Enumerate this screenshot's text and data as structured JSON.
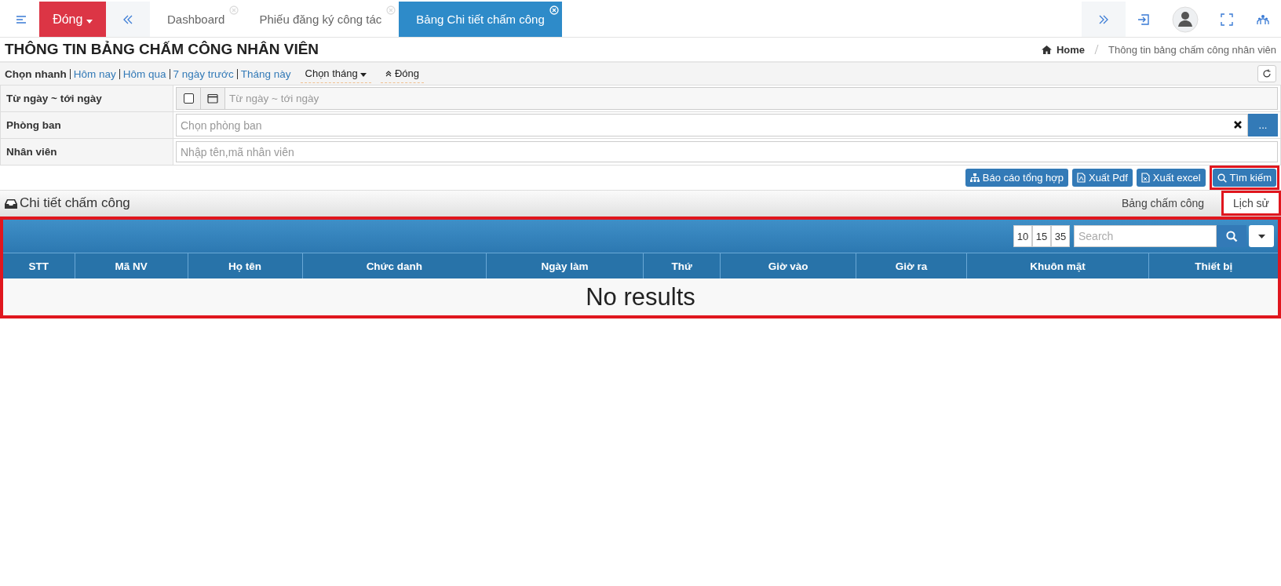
{
  "topbar": {
    "close_button": "Đóng",
    "tabs": [
      {
        "label": "Dashboard",
        "selected": false
      },
      {
        "label": "Phiếu đăng ký công tác",
        "selected": false
      },
      {
        "label": "Bảng Chi tiết chấm công",
        "selected": true
      }
    ]
  },
  "page": {
    "title": "THÔNG TIN BẢNG CHẤM CÔNG NHÂN VIÊN",
    "breadcrumb": [
      "Home",
      "Thông tin bảng chấm công nhân viên"
    ]
  },
  "quick_filter": {
    "label": "Chọn nhanh",
    "links": [
      "Hôm nay",
      "Hôm qua",
      "7 ngày trước",
      "Tháng này"
    ],
    "month_dropdown": "Chọn tháng",
    "collapse": "Đóng"
  },
  "form": [
    {
      "kind": "daterange",
      "label": "Từ ngày ~ tới ngày",
      "placeholder": "Từ ngày ~ tới ngày",
      "checked": false
    },
    {
      "kind": "picker",
      "label": "Phòng ban",
      "placeholder": "Chọn phòng ban",
      "picker_button": "..."
    },
    {
      "kind": "text",
      "label": "Nhân viên",
      "placeholder": "Nhập tên,mã nhân viên"
    }
  ],
  "actions": [
    "Báo cáo tổng hợp",
    "Xuất Pdf",
    "Xuất excel",
    "Tìm kiếm"
  ],
  "section": {
    "title": "Chi tiết chấm công",
    "tabs": [
      {
        "label": "Bảng chấm công",
        "selected": false
      },
      {
        "label": "Lịch sử",
        "selected": true
      }
    ]
  },
  "table": {
    "page_sizes": [
      "10",
      "15",
      "35"
    ],
    "search_placeholder": "Search",
    "columns": [
      "STT",
      "Mã NV",
      "Họ tên",
      "Chức danh",
      "Ngày làm",
      "Thứ",
      "Giờ vào",
      "Giờ ra",
      "Khuôn mặt",
      "Thiết bị"
    ],
    "empty_message": "No results"
  }
}
